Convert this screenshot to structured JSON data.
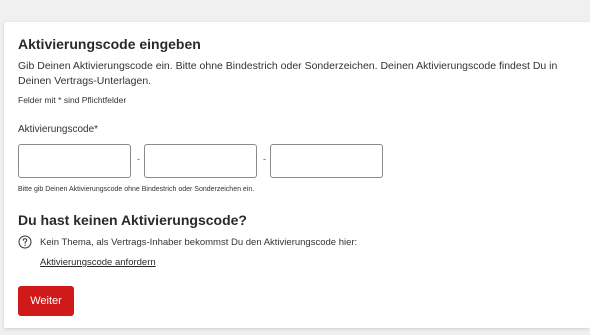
{
  "form": {
    "title": "Aktivierungscode eingeben",
    "intro": "Gib Deinen Aktivierungscode ein. Bitte ohne Bindestrich oder Sonderzeichen. Deinen Aktivierungscode findest Du in Deinen Vertrags-Unterlagen.",
    "required_note": "Felder mit * sind Pflichtfelder",
    "field_label": "Aktivierungscode*",
    "inputs": [
      {
        "value": "",
        "placeholder": ""
      },
      {
        "value": "",
        "placeholder": ""
      },
      {
        "value": "",
        "placeholder": ""
      }
    ],
    "separator": "-",
    "hint": "Bitte gib Deinen Aktivierungscode ohne Bindestrich oder Sonderzeichen ein."
  },
  "no_code": {
    "title": "Du hast keinen Aktivierungscode?",
    "help_icon": "question-circle-icon",
    "text": "Kein Thema, als Vertrags-Inhaber bekommst Du den Aktivierungscode hier:",
    "link_label": "Aktivierungscode anfordern"
  },
  "actions": {
    "next_label": "Weiter"
  },
  "colors": {
    "primary_button": "#d01a1a",
    "background": "#f0f0f0",
    "card": "#ffffff",
    "input_border": "#8a8a8a"
  }
}
